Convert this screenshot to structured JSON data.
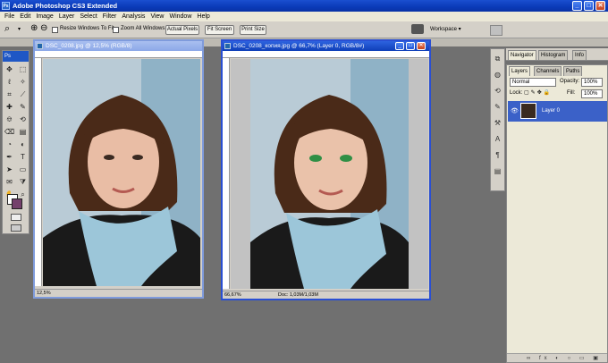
{
  "app": {
    "title": "Adobe Photoshop CS3 Extended",
    "icon_label": "Ps",
    "window_buttons": [
      "_",
      "□",
      "✕"
    ]
  },
  "menu": [
    "File",
    "Edit",
    "Image",
    "Layer",
    "Select",
    "Filter",
    "Analysis",
    "View",
    "Window",
    "Help"
  ],
  "options": {
    "resize_windows_label": "Resize Windows To Fit",
    "zoom_all_label": "Zoom All Windows",
    "actual_pixels": "Actual Pixels",
    "fit_screen": "Fit Screen",
    "print_size": "Print Size",
    "workspace": "Workspace ▾"
  },
  "toolbox": {
    "header": "Ps",
    "tools": [
      "move-tool",
      "marquee-tool",
      "lasso-tool",
      "magic-wand-tool",
      "crop-tool",
      "slice-tool",
      "healing-brush-tool",
      "brush-tool",
      "clone-stamp-tool",
      "history-brush-tool",
      "eraser-tool",
      "gradient-tool",
      "blur-tool",
      "dodge-tool",
      "pen-tool",
      "type-tool",
      "path-selection-tool",
      "shape-tool",
      "notes-tool",
      "eyedropper-tool",
      "hand-tool",
      "zoom-tool"
    ],
    "glyphs": [
      "✥",
      "⬚",
      "ℓ",
      "✧",
      "⌗",
      "⟋",
      "✚",
      "✎",
      "⎊",
      "⟲",
      "⌫",
      "▤",
      "◔",
      "◐",
      "✒",
      "T",
      "➤",
      "▭",
      "✉",
      "⧩",
      "✋",
      "⌕"
    ]
  },
  "doc1": {
    "title": "DSC_0208.jpg @ 12,5% (RGB/8)",
    "zoom": "12,5%"
  },
  "doc2": {
    "title": "DSC_0208_копия.jpg @ 66,7% (Layer 0, RGB/8#)",
    "zoom": "66,67%",
    "doc_size": "Doc: 1,03M/1,03M"
  },
  "navigator_tabs": [
    "Navigator",
    "Histogram",
    "Info"
  ],
  "layers_panel": {
    "tabs": [
      "Layers",
      "Channels",
      "Paths"
    ],
    "blend_mode": "Normal",
    "opacity_label": "Opacity:",
    "opacity": "100%",
    "lock_label": "Lock:",
    "fill_label": "Fill:",
    "fill": "100%",
    "layer_name": "Layer 0",
    "bottom_icons": "∞ fx ◐ ○ ▭ ▣ 🗑"
  },
  "colors": {
    "title_blue": "#0a3ab8",
    "layer_selected": "#3b61c8",
    "workspace_bg": "#707070"
  }
}
